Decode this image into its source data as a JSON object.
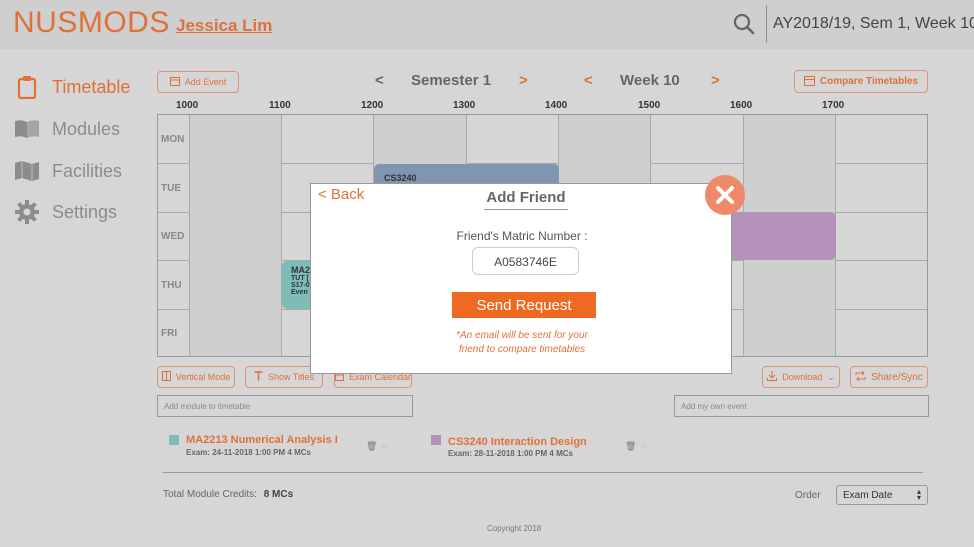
{
  "header": {
    "logo": "NUSMODS",
    "user_name": "Jessica Lim",
    "term": "AY2018/19, Sem 1, Week 10"
  },
  "sidebar": {
    "items": [
      {
        "label": "Timetable",
        "icon": "clipboard-icon",
        "active": true
      },
      {
        "label": "Modules",
        "icon": "book-icon",
        "active": false
      },
      {
        "label": "Facilities",
        "icon": "map-icon",
        "active": false
      },
      {
        "label": "Settings",
        "icon": "gear-icon",
        "active": false
      }
    ]
  },
  "toolbar": {
    "add_event": "Add Event",
    "semester_label": "Semester 1",
    "week_label": "Week 10",
    "prev": "<",
    "next": ">",
    "compare": "Compare Timetables"
  },
  "timetable": {
    "hours": [
      "1000",
      "1100",
      "1200",
      "1300",
      "1400",
      "1500",
      "1600",
      "1700"
    ],
    "days": [
      "MON",
      "TUE",
      "WED",
      "THU",
      "FRI"
    ],
    "lessons": [
      {
        "code": "CS3240",
        "lines": []
      },
      {
        "code": "MA2",
        "lines": [
          "TUT [",
          "S17-0",
          "Even"
        ]
      },
      {
        "code": "",
        "lines": []
      }
    ],
    "colors": {
      "cs3240": "#7f95b0",
      "ma2213": "#7dbcb8",
      "wed_event": "#b592b9"
    }
  },
  "actions": {
    "vertical_mode": "Vertical Mode",
    "show_titles": "Show Titles",
    "exam_calendar": "Exam Calendar",
    "download": "Download",
    "share_sync": "Share/Sync"
  },
  "inputs": {
    "add_module_placeholder": "Add module to timetable",
    "add_event_placeholder": "Add my own event"
  },
  "modules": [
    {
      "title": "MA2213 Numerical Analysis I",
      "exam": "Exam: 24-11-2018 1:00 PM   4 MCs",
      "color": "#7dbcb8"
    },
    {
      "title": "CS3240 Interaction Design",
      "exam": "Exam: 28-11-2018 1:00 PM   4 MCs",
      "color": "#b592b9"
    }
  ],
  "footer": {
    "credits_label": "Total Module Credits:",
    "credits_value": "8 MCs",
    "order_label": "Order",
    "order_value": "Exam Date",
    "copyright": "Copyright 2018"
  },
  "modal": {
    "back": "< Back",
    "title": "Add Friend",
    "field_label": "Friend's Matric Number :",
    "field_value": "A0583746E",
    "submit": "Send Request",
    "note_line1": "*An email will be sent for your",
    "note_line2": "friend to compare timetables"
  },
  "accent": "#e0703a"
}
